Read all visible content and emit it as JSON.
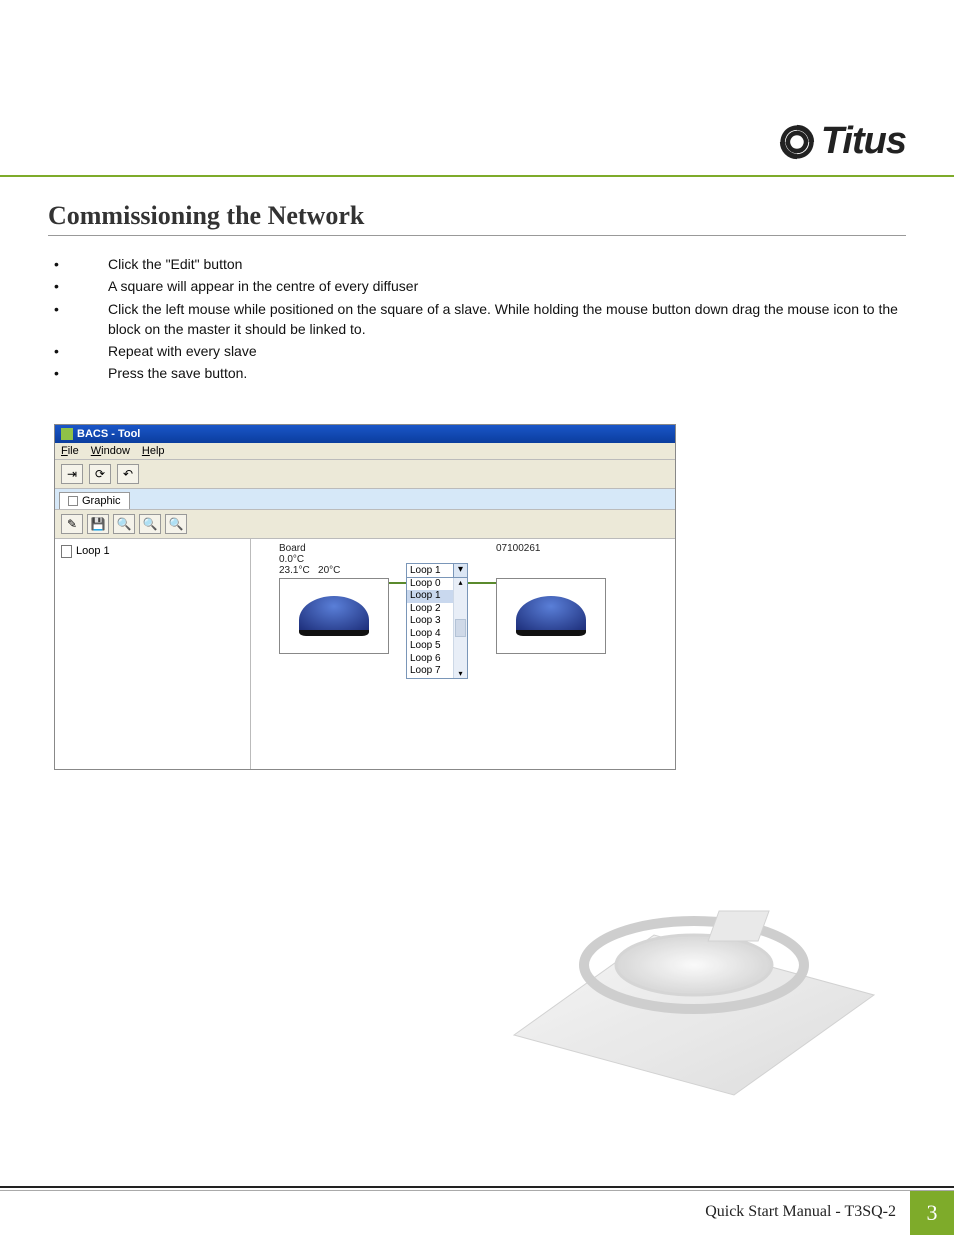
{
  "brand": {
    "name": "Titus"
  },
  "section": {
    "title": "Commissioning the Network"
  },
  "instructions": [
    "Click the \"Edit\" button",
    "A square will appear in the centre of every diffuser",
    "Click the left mouse while positioned on the square of a slave. While holding the mouse button down drag the mouse icon to the block on the master it should be linked to.",
    "Repeat with every slave",
    "Press the save button."
  ],
  "screenshot": {
    "title": "BACS  -  Tool",
    "menu": {
      "file": "File",
      "window": "Window",
      "help": "Help"
    },
    "tab": "Graphic",
    "tree": {
      "item0": "Loop 1"
    },
    "diffuser1": {
      "line1": "Board",
      "line2": "0.0°C",
      "line3a": "23.1°C",
      "line3b": "20°C"
    },
    "diffuser2": {
      "label": "07100261"
    },
    "dropdown": {
      "selected": "Loop 1",
      "items": [
        "Loop 0",
        "Loop 1",
        "Loop 2",
        "Loop 3",
        "Loop 4",
        "Loop 5",
        "Loop 6",
        "Loop 7"
      ]
    }
  },
  "footer": {
    "text": "Quick Start Manual - T3SQ-2",
    "page": "3"
  }
}
